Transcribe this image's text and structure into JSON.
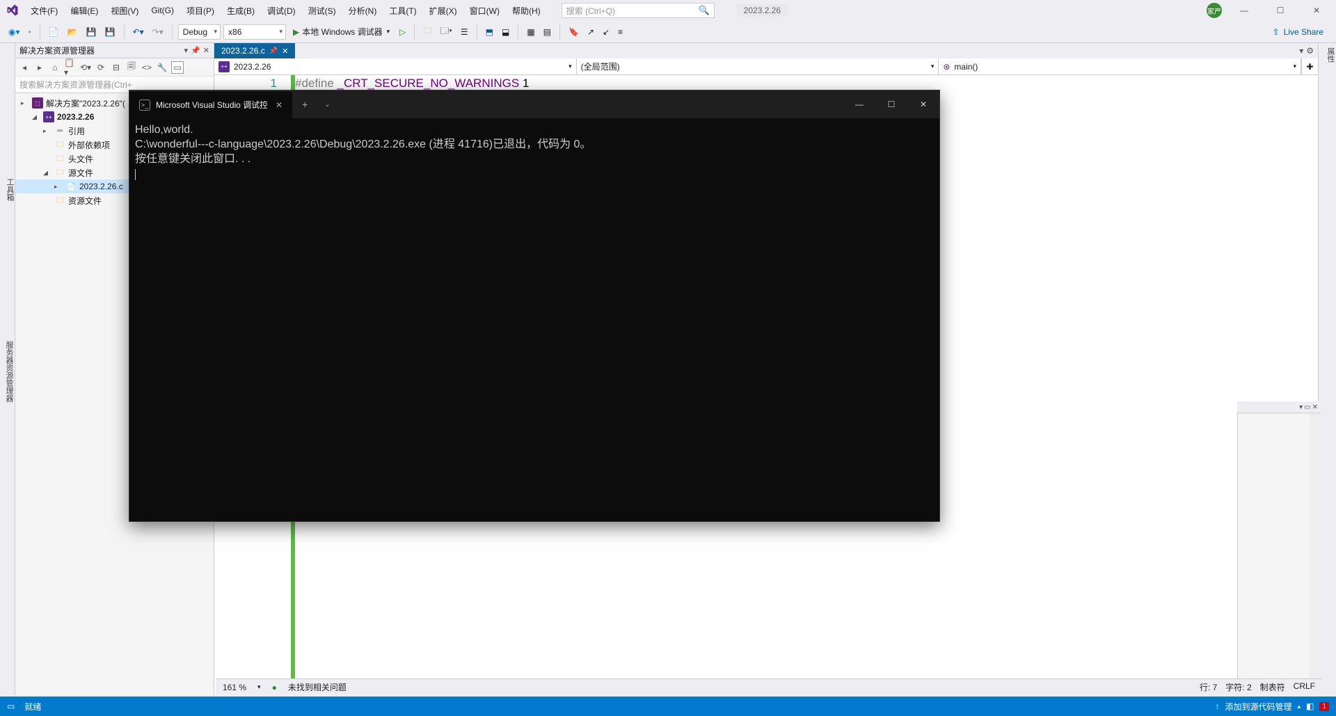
{
  "menubar": {
    "items": [
      "文件(F)",
      "编辑(E)",
      "视图(V)",
      "Git(G)",
      "项目(P)",
      "生成(B)",
      "调试(D)",
      "测试(S)",
      "分析(N)",
      "工具(T)",
      "扩展(X)",
      "窗口(W)",
      "帮助(H)"
    ],
    "search_placeholder": "搜索 (Ctrl+Q)",
    "version": "2023.2.26",
    "avatar_text": "家严"
  },
  "toolbar": {
    "config": "Debug",
    "platform": "x86",
    "run_label": "本地 Windows 调试器",
    "live_share": "Live Share"
  },
  "solution": {
    "title": "解决方案资源管理器",
    "search_placeholder": "搜索解决方案资源管理器(Ctrl+",
    "root": "解决方案\"2023.2.26\"(",
    "project": "2023.2.26",
    "refs": "引用",
    "external": "外部依赖项",
    "headers": "头文件",
    "sources": "源文件",
    "file": "2023.2.26.c",
    "resources": "资源文件"
  },
  "left_tabs": {
    "a": "服务器资源管理器",
    "b": "工具箱"
  },
  "right_tab": "属性",
  "editor": {
    "tab": "2023.2.26.c",
    "nav_project": "2023.2.26",
    "nav_scope": "(全局范围)",
    "nav_function": "main()",
    "line_no": "1",
    "code_define": "#define ",
    "code_macro": "_CRT_SECURE_NO_WARNINGS",
    "code_val": " 1"
  },
  "editor_status": {
    "zoom": "161 %",
    "issues": "未找到相关问题",
    "line": "行: 7",
    "char": "字符: 2",
    "tabs": "制表符",
    "eol": "CRLF"
  },
  "console": {
    "tab_title": "Microsoft Visual Studio 调试控",
    "line1": "Hello,world.",
    "line2": "C:\\wonderful---c-language\\2023.2.26\\Debug\\2023.2.26.exe (进程 41716)已退出，代码为 0。",
    "line3": "按任意键关闭此窗口. . ."
  },
  "statusbar": {
    "ready": "就绪",
    "scm": "添加到源代码管理",
    "notif": "1"
  }
}
